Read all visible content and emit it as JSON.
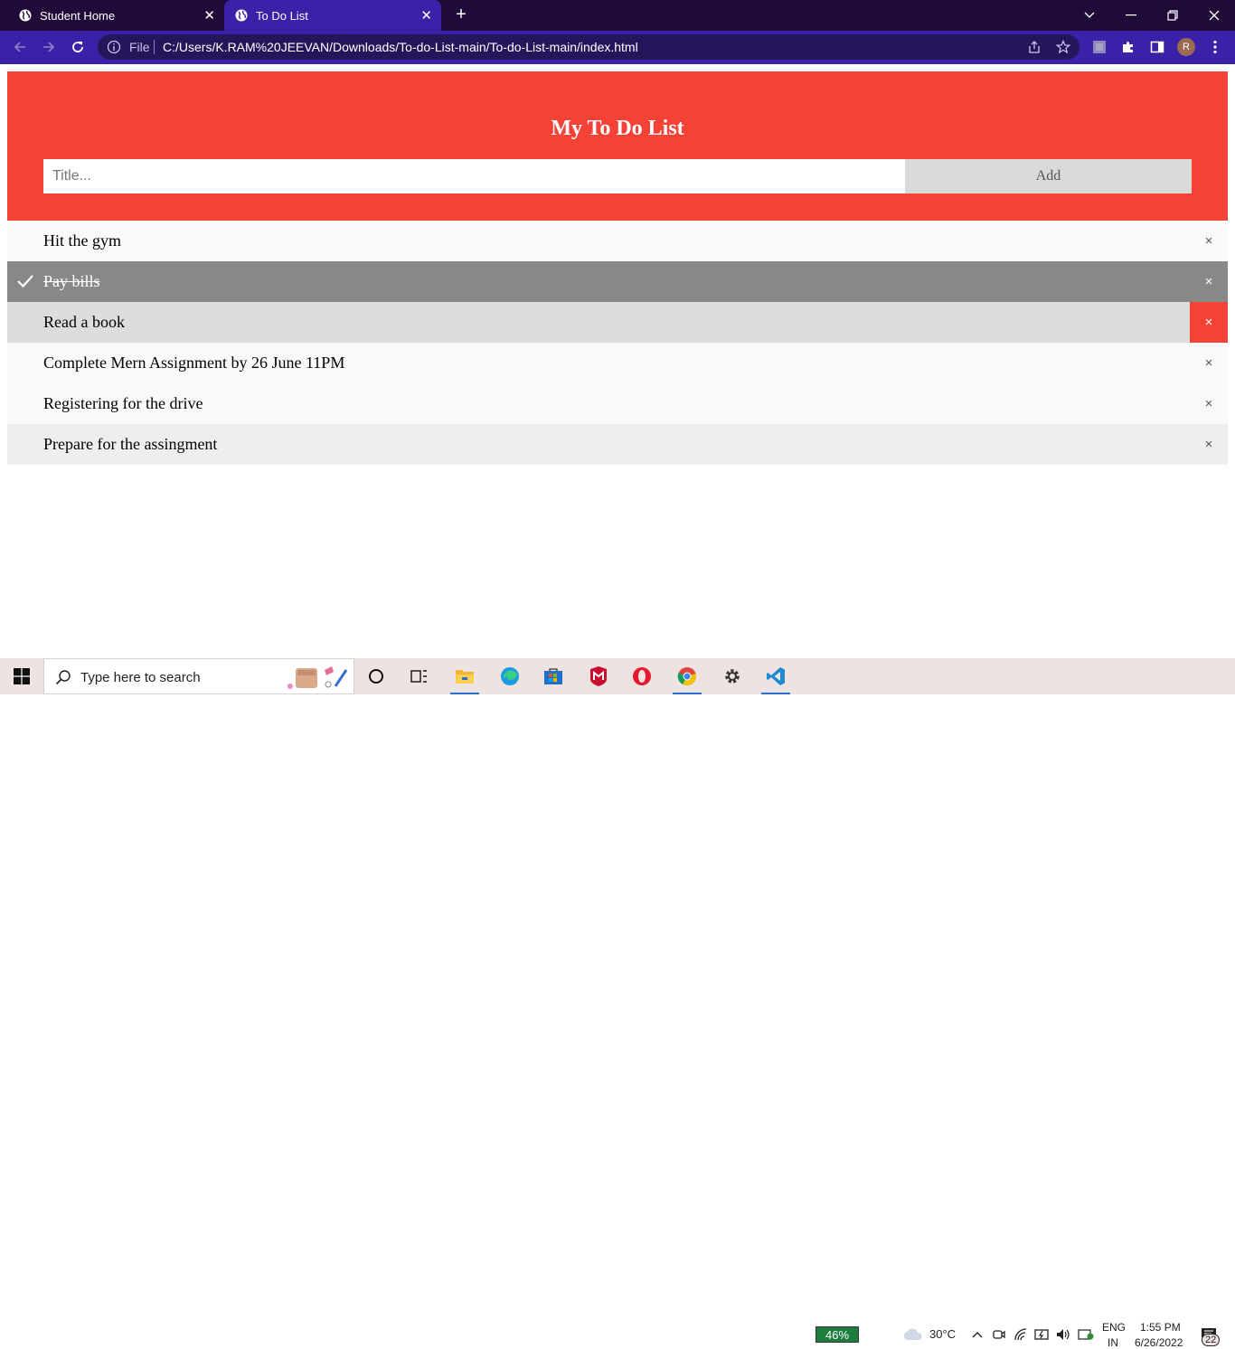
{
  "browser": {
    "tabs": [
      {
        "label": "Student Home",
        "close": "✕"
      },
      {
        "label": "To Do List",
        "close": "✕"
      }
    ],
    "new_tab": "+",
    "address": {
      "file_label": "File",
      "url": "C:/Users/K.RAM%20JEEVAN/Downloads/To-do-List-main/To-do-List-main/index.html"
    },
    "profile_initial": "R"
  },
  "app": {
    "title": "My To Do List",
    "input": {
      "placeholder": "Title...",
      "value": ""
    },
    "add_label": "Add",
    "close_glyph": "×",
    "items": [
      {
        "text": "Hit the gym",
        "checked": false
      },
      {
        "text": "Pay bills",
        "checked": true
      },
      {
        "text": "Read a book",
        "checked": false
      },
      {
        "text": "Complete Mern Assignment by 26 June 11PM",
        "checked": false
      },
      {
        "text": "Registering for the drive",
        "checked": false
      },
      {
        "text": "Prepare for the assingment",
        "checked": false
      }
    ]
  },
  "taskbar": {
    "search_placeholder": "Type here to search",
    "battery": "46%",
    "weather": "30°C",
    "lang": "ENG",
    "region": "IN",
    "time": "1:55 PM",
    "date": "6/26/2022",
    "notifications": "22"
  },
  "colors": {
    "accent": "#f44336",
    "chrome_tabbar": "#200a3a",
    "chrome_toolbar": "#3b21a7"
  }
}
